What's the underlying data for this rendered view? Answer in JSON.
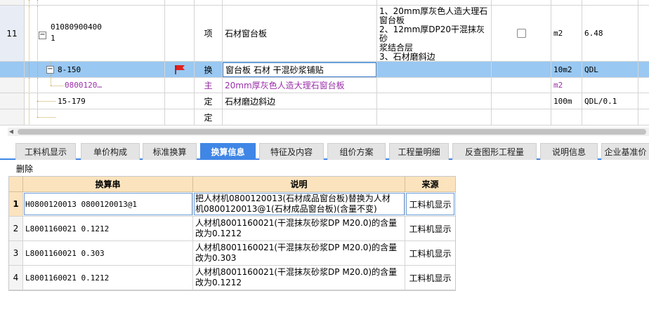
{
  "grid": {
    "rows": [
      {
        "num": "",
        "code": "",
        "type": "",
        "name": "",
        "desc": "",
        "unit": "",
        "qty": ""
      },
      {
        "num": "11",
        "code_line1": "01080900400",
        "code_line2": "1",
        "type": "项",
        "name": "石材窗台板",
        "desc_lines": [
          "1、20mm厚灰色人造大理石",
          "窗台板",
          "2、12mm厚DP20干混抹灰砂",
          "浆结合层",
          "3、石材磨斜边"
        ],
        "unit": "m2",
        "qty": "6.48"
      },
      {
        "num": "",
        "code": "8-150",
        "type": "换",
        "name": "窗台板 石材 干混砂浆铺贴",
        "unit": "10m2",
        "qty": "QDL"
      },
      {
        "num": "",
        "code": "0800120…",
        "type": "主",
        "name": "20mm厚灰色人造大理石窗台板",
        "unit": "m2",
        "qty": ""
      },
      {
        "num": "",
        "code": "15-179",
        "type": "定",
        "name": "石材磨边斜边",
        "unit": "100m",
        "qty": "QDL/0.1"
      },
      {
        "num": "",
        "code": "",
        "type": "定",
        "name": "",
        "unit": "",
        "qty": ""
      }
    ]
  },
  "tabs": [
    {
      "label": "工料机显示",
      "active": false
    },
    {
      "label": "单价构成",
      "active": false
    },
    {
      "label": "标准换算",
      "active": false
    },
    {
      "label": "换算信息",
      "active": true
    },
    {
      "label": "特征及内容",
      "active": false
    },
    {
      "label": "组价方案",
      "active": false
    },
    {
      "label": "工程量明细",
      "active": false
    },
    {
      "label": "反查图形工程量",
      "active": false
    },
    {
      "label": "说明信息",
      "active": false
    },
    {
      "label": "企业基准价",
      "active": false
    }
  ],
  "toolbar": {
    "delete_label": "删除"
  },
  "sub_grid": {
    "headers": {
      "string": "换算串",
      "desc": "说明",
      "source": "来源"
    },
    "rows": [
      {
        "num": "1",
        "string": "H0800120013 0800120013@1",
        "desc_lines": [
          "把人材机0800120013(石材成品窗台板)替换为人材",
          "机0800120013@1(石材成品窗台板)(含量不变)"
        ],
        "source": "工料机显示"
      },
      {
        "num": "2",
        "string": "L8001160021 0.1212",
        "desc_lines": [
          "人材机8001160021(干混抹灰砂浆DP M20.0)的含量",
          "改为0.1212"
        ],
        "source": "工料机显示"
      },
      {
        "num": "3",
        "string": "L8001160021 0.303",
        "desc_lines": [
          "人材机8001160021(干混抹灰砂浆DP M20.0)的含量",
          "改为0.303"
        ],
        "source": "工料机显示"
      },
      {
        "num": "4",
        "string": "L8001160021 0.1212",
        "desc_lines": [
          "人材机8001160021(干混抹灰砂浆DP M20.0)的含量",
          "改为0.1212"
        ],
        "source": "工料机显示"
      }
    ]
  },
  "colors": {
    "accent": "#3f86e6",
    "selected_row": "#99c8f2",
    "header_bg": "#fbe3bd",
    "main_material": "#9a2fa8",
    "flag": "#e0201f"
  },
  "icons": {
    "flag": "red-flag-icon",
    "collapse": "minus-box-icon"
  }
}
